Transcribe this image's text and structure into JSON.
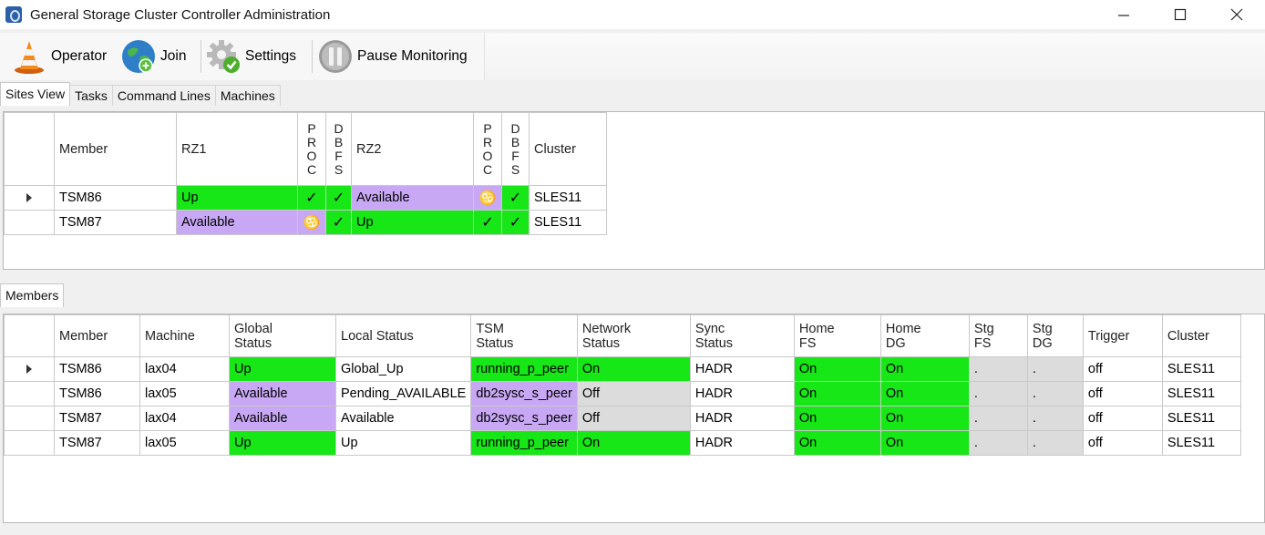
{
  "window": {
    "title": "General Storage Cluster Controller Administration"
  },
  "toolbar": {
    "operator": "Operator",
    "join": "Join",
    "settings": "Settings",
    "pause": "Pause Monitoring"
  },
  "top_tabs": [
    "Sites View",
    "Tasks",
    "Command Lines",
    "Machines"
  ],
  "sites": {
    "headers": {
      "member": "Member",
      "rz1": "RZ1",
      "proc1": [
        "P",
        "R",
        "O",
        "C"
      ],
      "dbfs1": [
        "D",
        "B",
        "F",
        "S"
      ],
      "rz2": "RZ2",
      "proc2": [
        "P",
        "R",
        "O",
        "C"
      ],
      "dbfs2": [
        "D",
        "B",
        "F",
        "S"
      ],
      "cluster": "Cluster"
    },
    "rows": [
      {
        "member": "TSM86",
        "rz1": "Up",
        "proc1": "✓",
        "dbfs1": "✓",
        "rz2": "Available",
        "proc2": "♋",
        "dbfs2": "✓",
        "cluster": "SLES11"
      },
      {
        "member": "TSM87",
        "rz1": "Available",
        "proc1": "♋",
        "dbfs1": "✓",
        "rz2": "Up",
        "proc2": "✓",
        "dbfs2": "✓",
        "cluster": "SLES11"
      }
    ]
  },
  "members_tab": "Members",
  "members": {
    "headers": {
      "member": "Member",
      "machine": "Machine",
      "global_status": [
        "Global",
        "Status"
      ],
      "local_status": "Local Status",
      "tsm_status": [
        "TSM",
        "Status"
      ],
      "network_status": [
        "Network",
        "Status"
      ],
      "sync_status": [
        "Sync",
        "Status"
      ],
      "home_fs": [
        "Home",
        "FS"
      ],
      "home_dg": [
        "Home",
        "DG"
      ],
      "stg_fs": [
        "Stg",
        "FS"
      ],
      "stg_dg": [
        "Stg",
        "DG"
      ],
      "trigger": "Trigger",
      "cluster": "Cluster"
    },
    "rows": [
      {
        "member": "TSM86",
        "machine": "lax04",
        "global": "Up",
        "local": "Global_Up",
        "tsm": "running_p_peer",
        "network": "On",
        "sync": "HADR",
        "home_fs": "On",
        "home_dg": "On",
        "stg_fs": ".",
        "stg_dg": ".",
        "trigger": "off",
        "cluster": "SLES11"
      },
      {
        "member": "TSM86",
        "machine": "lax05",
        "global": "Available",
        "local": "Pending_AVAILABLE",
        "tsm": "db2sysc_s_peer",
        "network": "Off",
        "sync": "HADR",
        "home_fs": "On",
        "home_dg": "On",
        "stg_fs": ".",
        "stg_dg": ".",
        "trigger": "off",
        "cluster": "SLES11"
      },
      {
        "member": "TSM87",
        "machine": "lax04",
        "global": "Available",
        "local": "Available",
        "tsm": "db2sysc_s_peer",
        "network": "Off",
        "sync": "HADR",
        "home_fs": "On",
        "home_dg": "On",
        "stg_fs": ".",
        "stg_dg": ".",
        "trigger": "off",
        "cluster": "SLES11"
      },
      {
        "member": "TSM87",
        "machine": "lax05",
        "global": "Up",
        "local": "Up",
        "tsm": "running_p_peer",
        "network": "On",
        "sync": "HADR",
        "home_fs": "On",
        "home_dg": "On",
        "stg_fs": ".",
        "stg_dg": ".",
        "trigger": "off",
        "cluster": "SLES11"
      }
    ]
  },
  "colors": {
    "up_green": "#17e617",
    "available_purple": "#c8a8f4",
    "off_gray": "#dcdcdc"
  },
  "icons": {
    "operator": "traffic-cone-icon",
    "join": "globe-icon",
    "settings": "gear-check-icon",
    "pause": "pause-icon",
    "proc_warning": "cancer-symbol-icon",
    "check": "check-icon",
    "row_current": "row-arrow-icon"
  }
}
